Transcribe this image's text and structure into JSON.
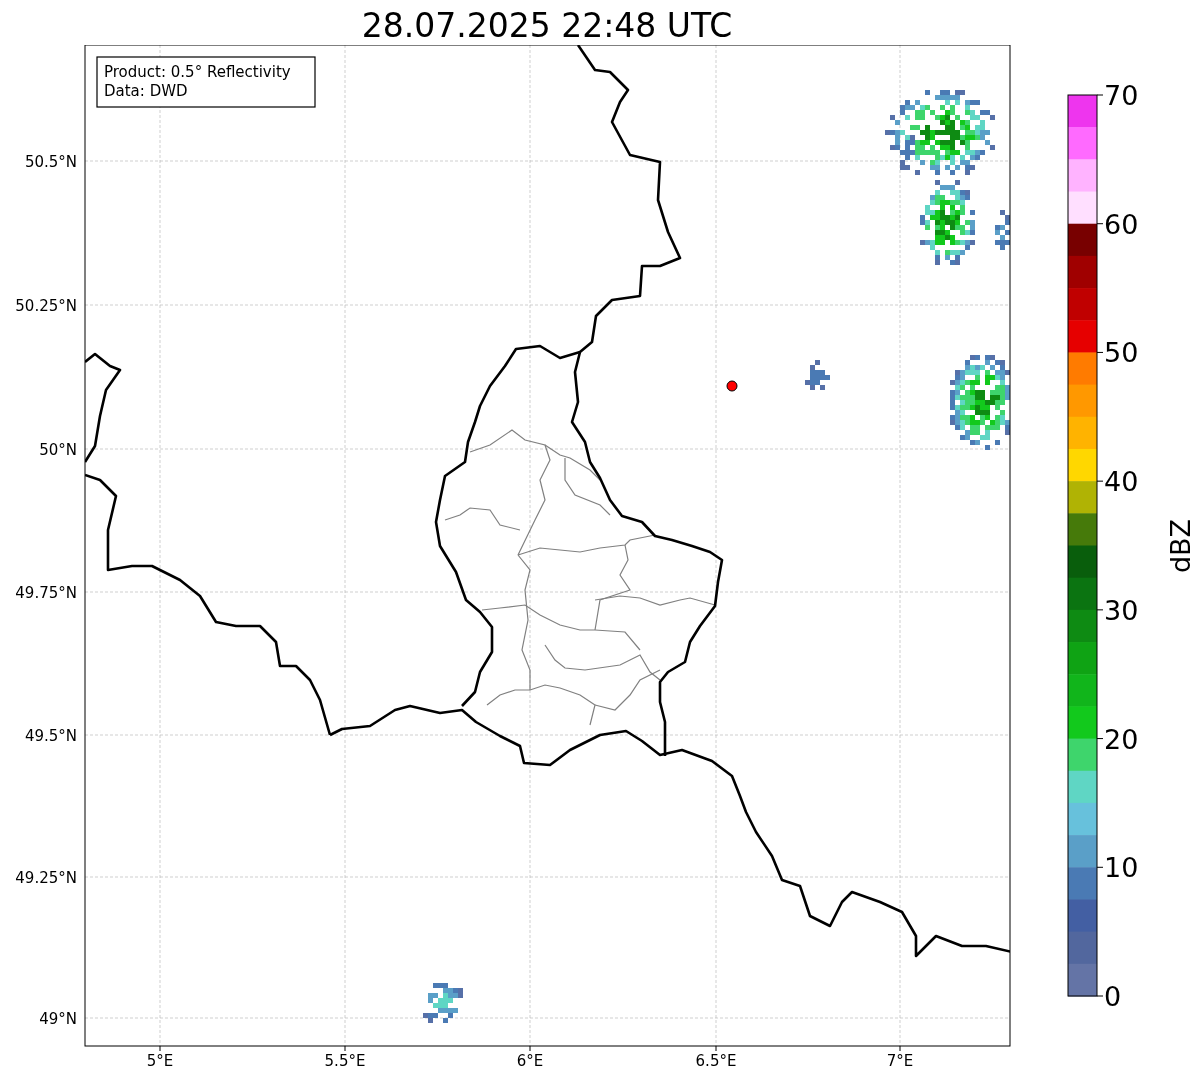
{
  "title": "28.07.2025 22:48 UTC",
  "info_box": [
    "Product: 0.5° Reflectivity",
    "Data: DWD"
  ],
  "x_ticks": [
    "5°E",
    "5.5°E",
    "6°E",
    "6.5°E",
    "7°E"
  ],
  "y_ticks": [
    "50.5°N",
    "50.25°N",
    "50°N",
    "49.75°N",
    "49.5°N",
    "49.25°N",
    "49°N"
  ],
  "colorbar": {
    "label": "dBZ",
    "ticks": [
      "70",
      "60",
      "50",
      "40",
      "30",
      "20",
      "10",
      "0"
    ],
    "segments": [
      {
        "color": "#ee35ee"
      },
      {
        "color": "#ff6aff"
      },
      {
        "color": "#ffb3ff"
      },
      {
        "color": "#ffdfff"
      },
      {
        "color": "#780000"
      },
      {
        "color": "#a00000"
      },
      {
        "color": "#c00000"
      },
      {
        "color": "#e60000"
      },
      {
        "color": "#ff7b00"
      },
      {
        "color": "#ff9800"
      },
      {
        "color": "#ffb300"
      },
      {
        "color": "#ffd700"
      },
      {
        "color": "#b0b304"
      },
      {
        "color": "#467a0a"
      },
      {
        "color": "#095e0c"
      },
      {
        "color": "#0b7411"
      },
      {
        "color": "#0e8b13"
      },
      {
        "color": "#0fa314"
      },
      {
        "color": "#11b51b"
      },
      {
        "color": "#12c91c"
      },
      {
        "color": "#3ed56c"
      },
      {
        "color": "#5fd6c4"
      },
      {
        "color": "#67c1dc"
      },
      {
        "color": "#5a9fc8"
      },
      {
        "color": "#4a7ab4"
      },
      {
        "color": "#435fa3"
      },
      {
        "color": "#52679e"
      },
      {
        "color": "#6474a6"
      }
    ]
  }
}
